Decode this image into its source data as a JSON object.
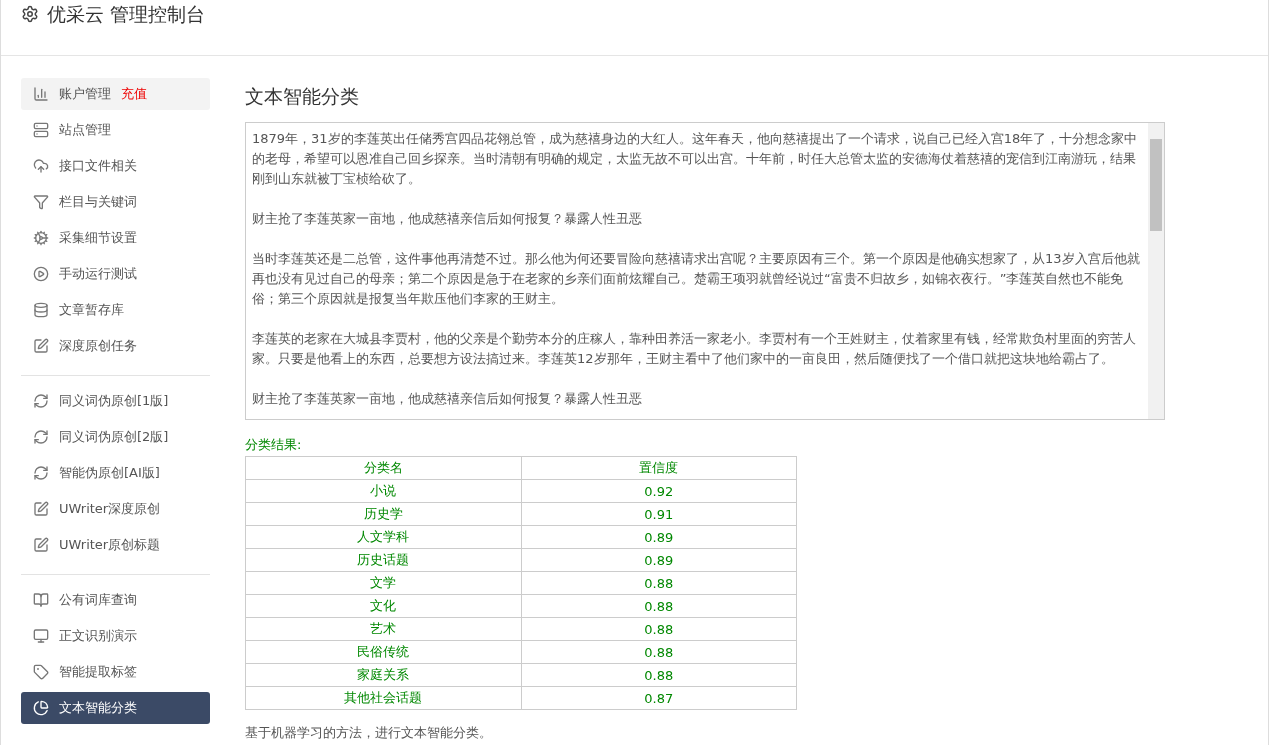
{
  "header": {
    "title": "优采云 管理控制台"
  },
  "sidebar": {
    "groups": [
      {
        "items": [
          {
            "label": "账户管理",
            "badge": "充值",
            "selected": false,
            "highlighted": true
          },
          {
            "label": "站点管理",
            "selected": false,
            "highlighted": false
          },
          {
            "label": "接口文件相关",
            "selected": false,
            "highlighted": false
          },
          {
            "label": "栏目与关键词",
            "selected": false,
            "highlighted": false
          },
          {
            "label": "采集细节设置",
            "selected": false,
            "highlighted": false
          },
          {
            "label": "手动运行测试",
            "selected": false,
            "highlighted": false
          },
          {
            "label": "文章暂存库",
            "selected": false,
            "highlighted": false
          },
          {
            "label": "深度原创任务",
            "selected": false,
            "highlighted": false
          }
        ]
      },
      {
        "items": [
          {
            "label": "同义词伪原创[1版]",
            "selected": false,
            "highlighted": false
          },
          {
            "label": "同义词伪原创[2版]",
            "selected": false,
            "highlighted": false
          },
          {
            "label": "智能伪原创[AI版]",
            "selected": false,
            "highlighted": false
          },
          {
            "label": "UWriter深度原创",
            "selected": false,
            "highlighted": false
          },
          {
            "label": "UWriter原创标题",
            "selected": false,
            "highlighted": false
          }
        ]
      },
      {
        "items": [
          {
            "label": "公有词库查询",
            "selected": false,
            "highlighted": false
          },
          {
            "label": "正文识别演示",
            "selected": false,
            "highlighted": false
          },
          {
            "label": "智能提取标签",
            "selected": false,
            "highlighted": false
          },
          {
            "label": "文本智能分类",
            "selected": true,
            "highlighted": false
          }
        ]
      }
    ]
  },
  "main": {
    "heading": "文本智能分类",
    "text_input": {
      "paragraphs": [
        "1879年，31岁的李莲英出任储秀宫四品花翎总管，成为慈禧身边的大红人。这年春天，他向慈禧提出了一个请求，说自己已经入宫18年了，十分想念家中的老母，希望可以恩准自己回乡探亲。当时清朝有明确的规定，太监无故不可以出宫。十年前，时任大总管太监的安德海仗着慈禧的宠信到江南游玩，结果刚到山东就被丁宝桢给砍了。",
        "财主抢了李莲英家一亩地，他成慈禧亲信后如何报复？暴露人性丑恶",
        "当时李莲英还是二总管，这件事他再清楚不过。那么他为何还要冒险向慈禧请求出宫呢？主要原因有三个。第一个原因是他确实想家了，从13岁入宫后他就再也没有见过自己的母亲；第二个原因是急于在老家的乡亲们面前炫耀自己。楚霸王项羽就曾经说过“富贵不归故乡，如锦衣夜行。”李莲英自然也不能免俗；第三个原因就是报复当年欺压他们李家的王财主。",
        "李莲英的老家在大城县李贾村，他的父亲是个勤劳本分的庄稼人，靠种田养活一家老小。李贾村有一个王姓财主，仗着家里有钱，经常欺负村里面的穷苦人家。只要是他看上的东西，总要想方设法搞过来。李莲英12岁那年，王财主看中了他们家中的一亩良田，然后随便找了一个借口就把这块地给霸占了。",
        "财主抢了李莲英家一亩地，他成慈禧亲信后如何报复？暴露人性丑恶"
      ]
    },
    "result_label": "分类结果:",
    "table": {
      "columns": [
        "分类名",
        "置信度"
      ],
      "rows": [
        [
          "小说",
          "0.92"
        ],
        [
          "历史学",
          "0.91"
        ],
        [
          "人文学科",
          "0.89"
        ],
        [
          "历史话题",
          "0.89"
        ],
        [
          "文学",
          "0.88"
        ],
        [
          "文化",
          "0.88"
        ],
        [
          "艺术",
          "0.88"
        ],
        [
          "民俗传统",
          "0.88"
        ],
        [
          "家庭关系",
          "0.88"
        ],
        [
          "其他社会话题",
          "0.87"
        ]
      ]
    },
    "note": "基于机器学习的方法，进行文本智能分类。"
  }
}
